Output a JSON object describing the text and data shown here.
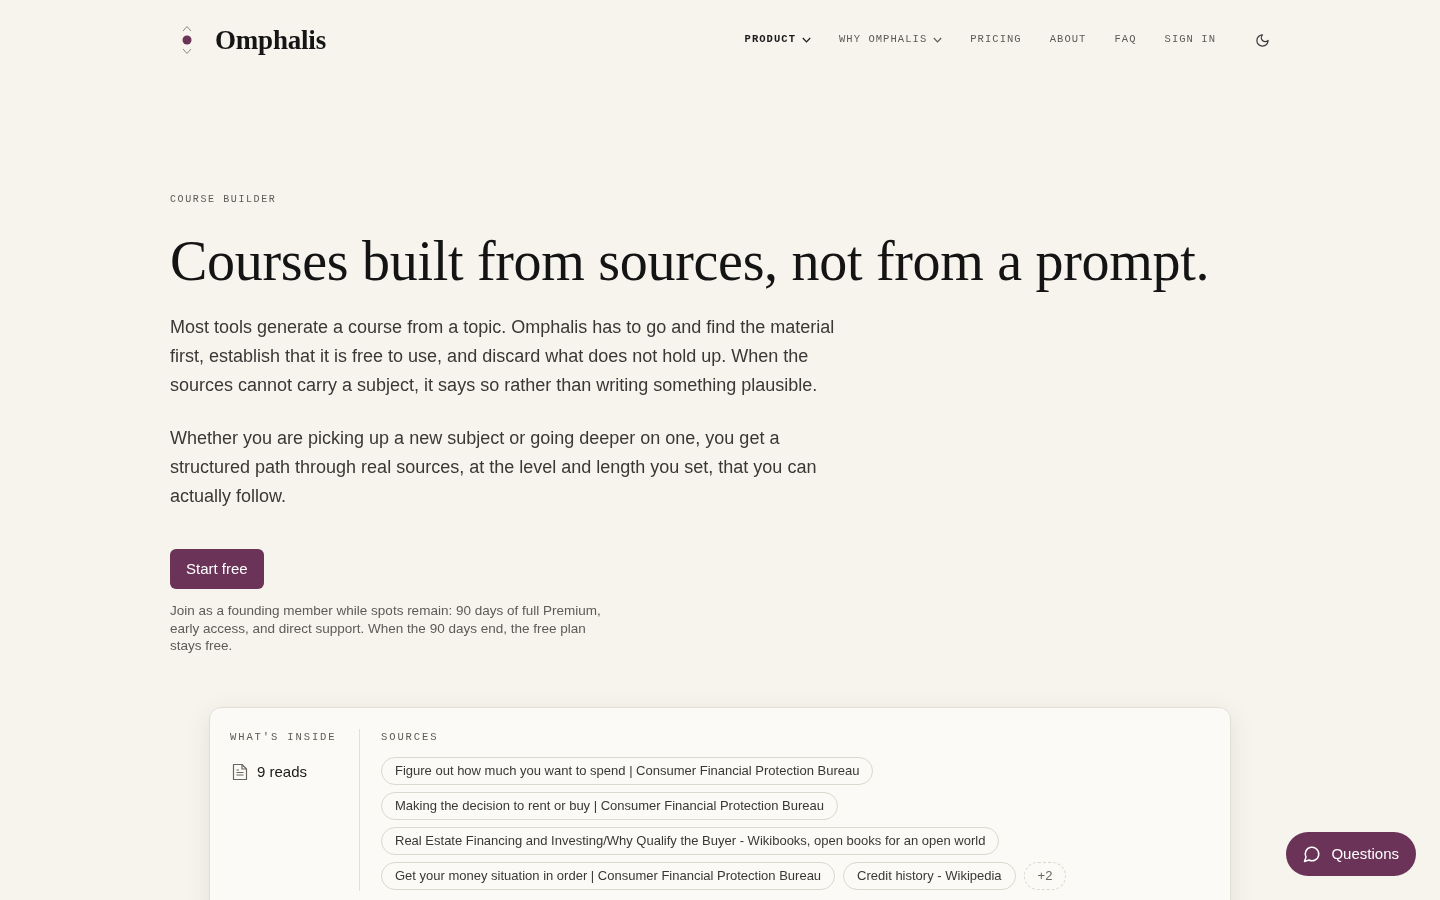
{
  "header": {
    "logo_text": "Omphalis",
    "nav": [
      {
        "label": "PRODUCT",
        "selected": true,
        "dropdown": true
      },
      {
        "label": "WHY OMPHALIS",
        "selected": false,
        "dropdown": true
      },
      {
        "label": "PRICING",
        "selected": false,
        "dropdown": false
      },
      {
        "label": "ABOUT",
        "selected": false,
        "dropdown": false
      },
      {
        "label": "FAQ",
        "selected": false,
        "dropdown": false
      },
      {
        "label": "SIGN IN",
        "selected": false,
        "dropdown": false
      }
    ]
  },
  "hero": {
    "eyebrow": "COURSE BUILDER",
    "title": "Courses built from sources, not from a prompt.",
    "paragraphs": [
      "Most tools generate a course from a topic. Omphalis has to go and find the material first, establish that it is free to use, and discard what does not hold up. When the sources cannot carry a subject, it says so rather than writing something plausible.",
      "Whether you are picking up a new subject or going deeper on one, you get a structured path through real sources, at the level and length you set, that you can actually follow."
    ],
    "cta": "Start free",
    "note": "Join as a founding member while spots remain: 90 days of full Premium, early access, and direct support. When the 90 days end, the free plan stays free."
  },
  "card": {
    "inside_label": "WHAT'S INSIDE",
    "reads": "9 reads",
    "sources_label": "SOURCES",
    "sources": [
      {
        "label": "Figure out how much you want to spend | Consumer Financial Protection Bureau",
        "kind": "source"
      },
      {
        "label": "Making the decision to rent or buy | Consumer Financial Protection Bureau",
        "kind": "source"
      },
      {
        "label": "Real Estate Financing and Investing/Why Qualify the Buyer - Wikibooks, open books for an open world",
        "kind": "source"
      },
      {
        "label": "Get your money situation in order | Consumer Financial Protection Bureau",
        "kind": "source"
      },
      {
        "label": "Credit history - Wikipedia",
        "kind": "source"
      },
      {
        "label": "+2",
        "kind": "more"
      }
    ]
  },
  "chat_button": "Questions"
}
